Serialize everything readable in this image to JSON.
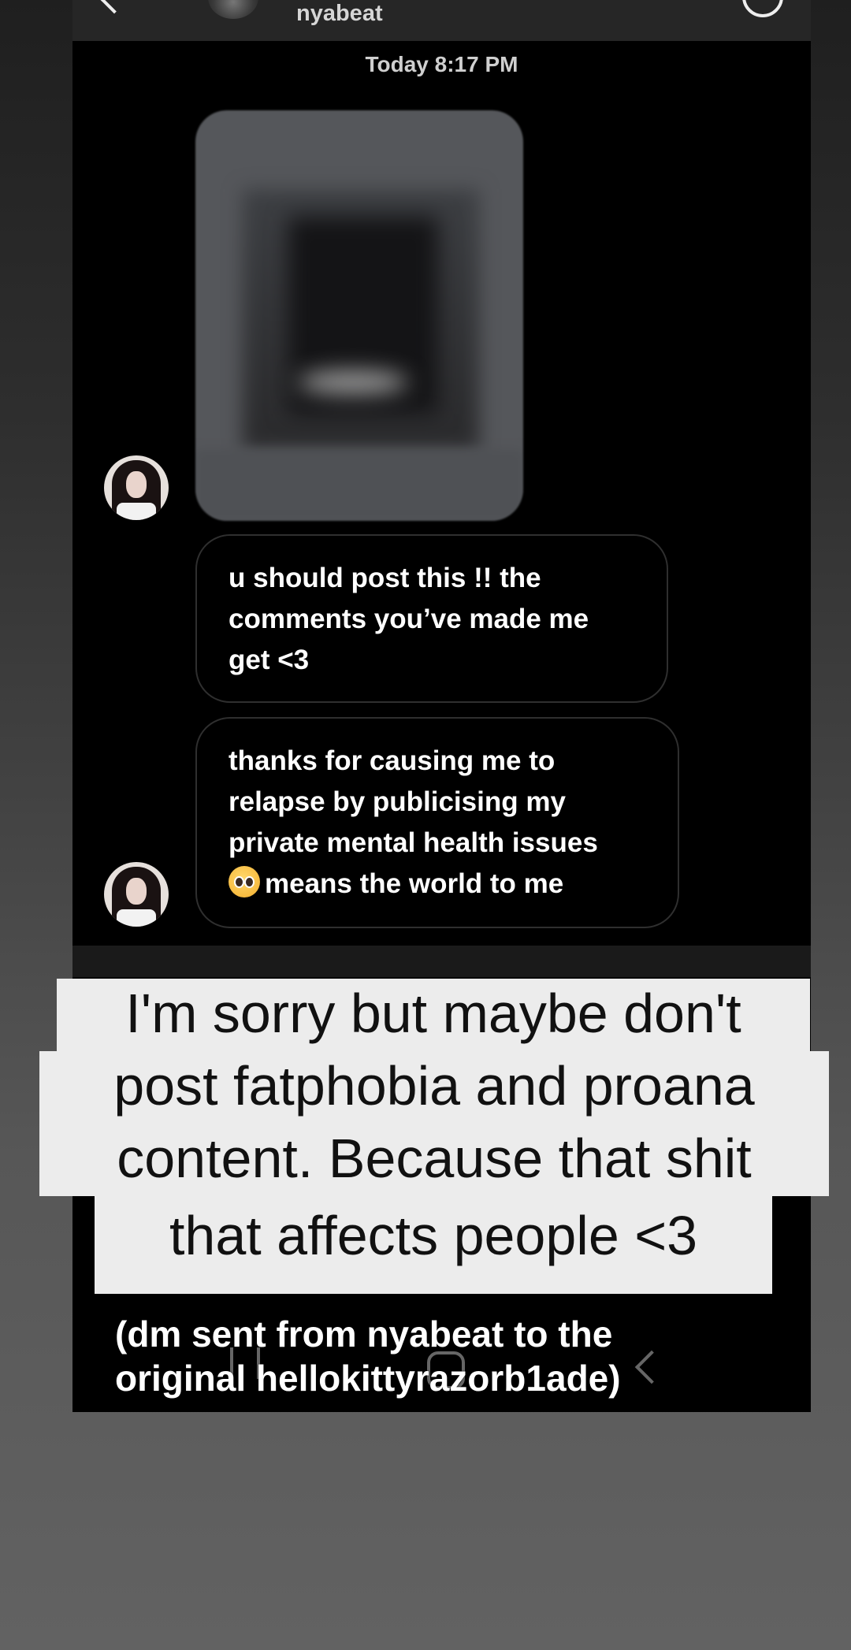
{
  "header": {
    "contact_name": "nyabeat",
    "icons": [
      "back-arrow-icon",
      "contact-avatar",
      "info-icon"
    ]
  },
  "conversation": {
    "timestamp": "Today 8:17 PM",
    "photo_message": "blurred image",
    "messages": [
      {
        "lines": [
          "u should post this !! the",
          "comments you’ve made me",
          "get <3"
        ]
      },
      {
        "lines": [
          "thanks for causing me to",
          "relapse by publicising my",
          "private mental health issues"
        ],
        "last_line": "means the world to me",
        "emoji": "pleading-face"
      }
    ]
  },
  "caption": {
    "lines": [
      "I'm sorry but maybe don't",
      "post fatphobia and proana",
      "content. Because that shit",
      "that affects people <3"
    ]
  },
  "footer": {
    "lines": [
      "(dm sent from nyabeat to the",
      "original hellokittyrazorb1ade)"
    ]
  },
  "colors": {
    "chat_background": "#000000",
    "caption_background": "#ececec",
    "bubble_border": "#2f2f2f"
  }
}
